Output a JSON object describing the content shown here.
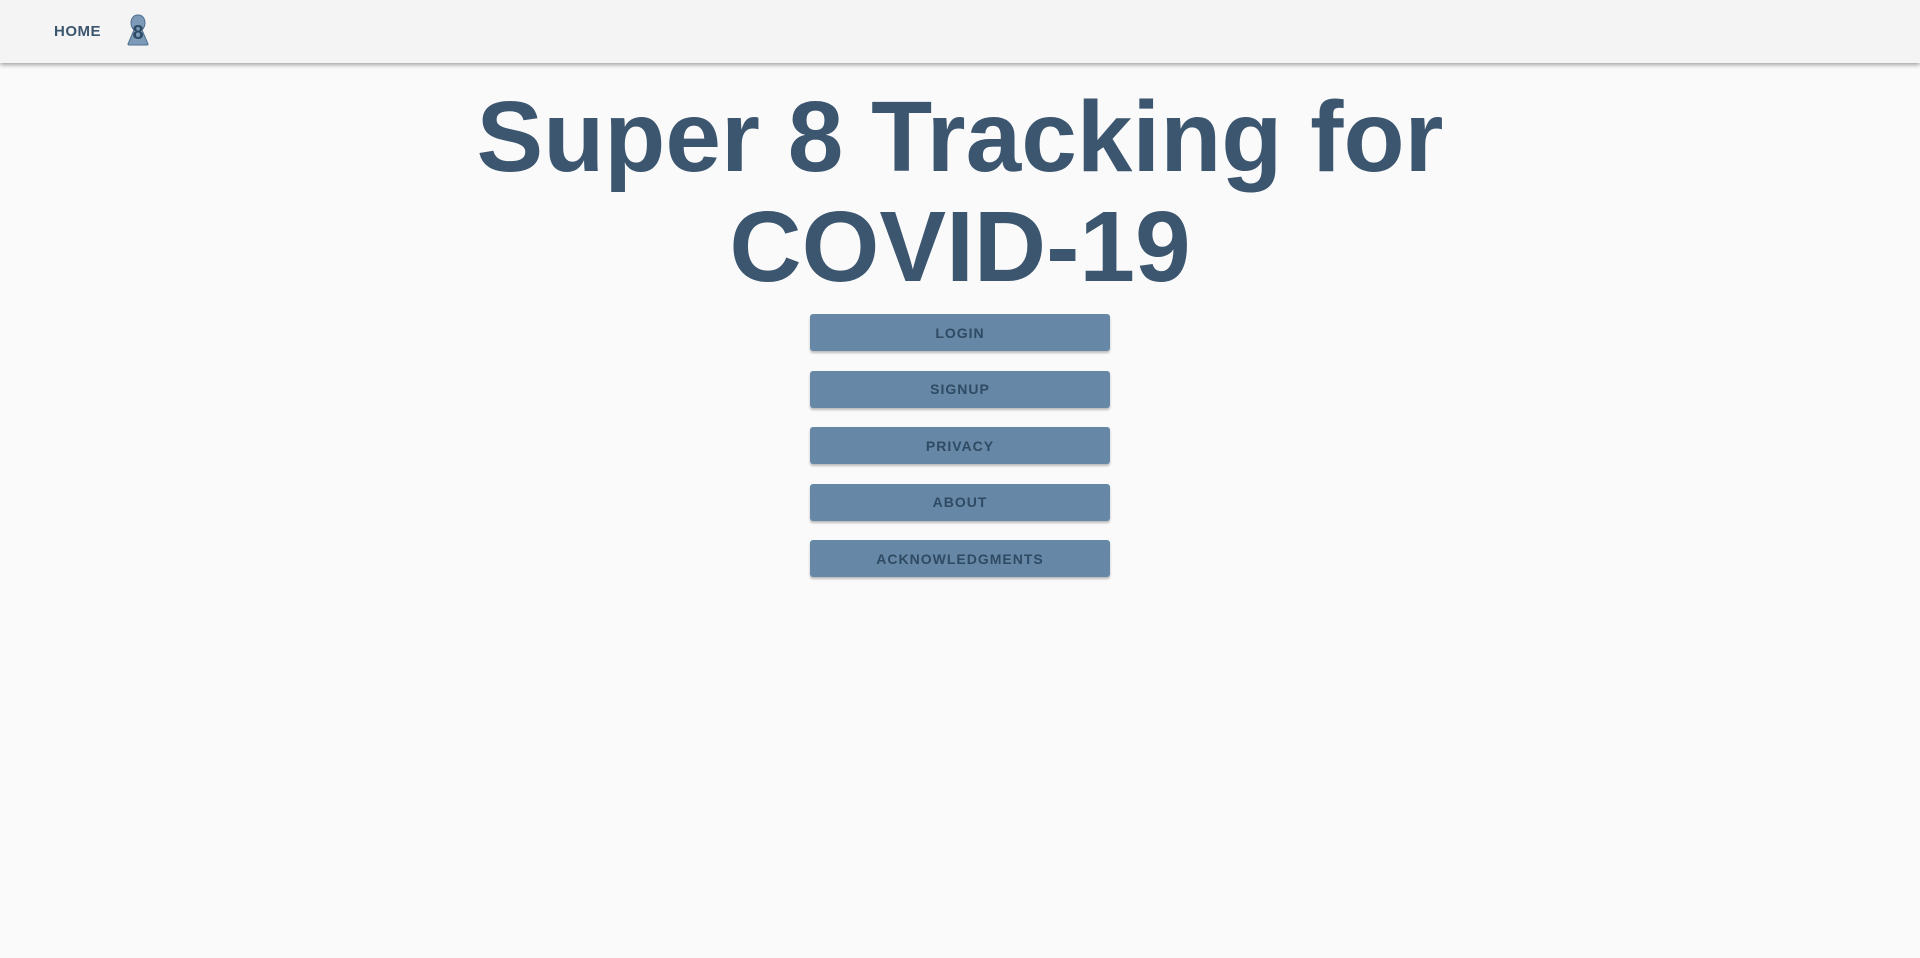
{
  "nav": {
    "home_label": "HOME",
    "logo_icon": "super-8-logo-icon",
    "logo_digit": "8"
  },
  "hero": {
    "title_line1": "Super 8 Tracking for",
    "title_line2": "COVID-19"
  },
  "menu": {
    "buttons": [
      {
        "label": "LOGIN"
      },
      {
        "label": "SIGNUP"
      },
      {
        "label": "PRIVACY"
      },
      {
        "label": "ABOUT"
      },
      {
        "label": "ACKNOWLEDGMENTS"
      }
    ]
  },
  "colors": {
    "primary_text": "#3c5670",
    "button_bg": "#6687a6",
    "button_text": "#2f4a63",
    "topbar_bg": "#f4f4f4",
    "page_bg": "#fafafa"
  }
}
